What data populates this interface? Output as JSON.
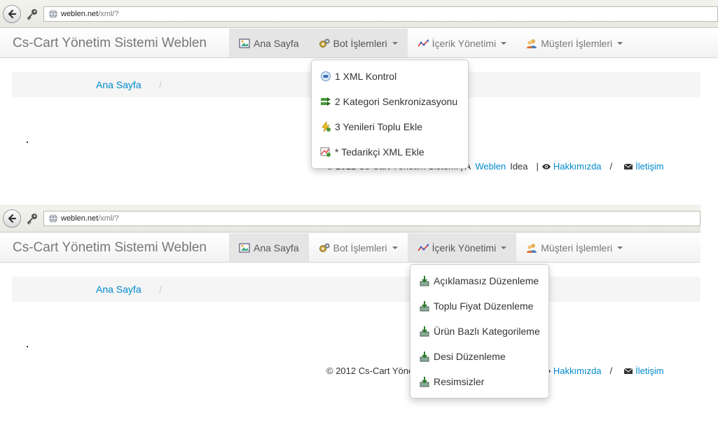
{
  "browser": {
    "url_host": "weblen.net",
    "url_path": "/xml/?"
  },
  "app": {
    "brand": "Cs-Cart Yönetim Sistemi Weblen"
  },
  "nav": {
    "home": "Ana Sayfa",
    "bot": "Bot İşlemleri",
    "content": "İçerik Yönetimi",
    "customer": "Müşteri İşlemleri"
  },
  "breadcrumb": {
    "home": "Ana Sayfa",
    "separator": "/"
  },
  "footer": {
    "copyright": "© 2012 Cs-Cart Yönetim Sistemi | A",
    "brand_link": "Weblen",
    "idea": "Idea",
    "pipe": "|",
    "about": "Hakkımızda",
    "slash": "/",
    "contact": "İletişim"
  },
  "bot_menu": {
    "items": [
      "1 XML Kontrol",
      "2 Kategori Senkronizasyonu",
      "3 Yenileri Toplu Ekle",
      "* Tedarikçi XML Ekle"
    ]
  },
  "content_menu": {
    "items": [
      "Açıklamasız Düzenleme",
      "Toplu Fiyat Düzenleme",
      "Ürün Bazlı Kategorileme",
      "Desi Düzenleme",
      "Resimsizler"
    ]
  },
  "colors": {
    "link": "#0088cc",
    "navbar_active": "#e5e5e5",
    "brand_text": "#777777"
  }
}
